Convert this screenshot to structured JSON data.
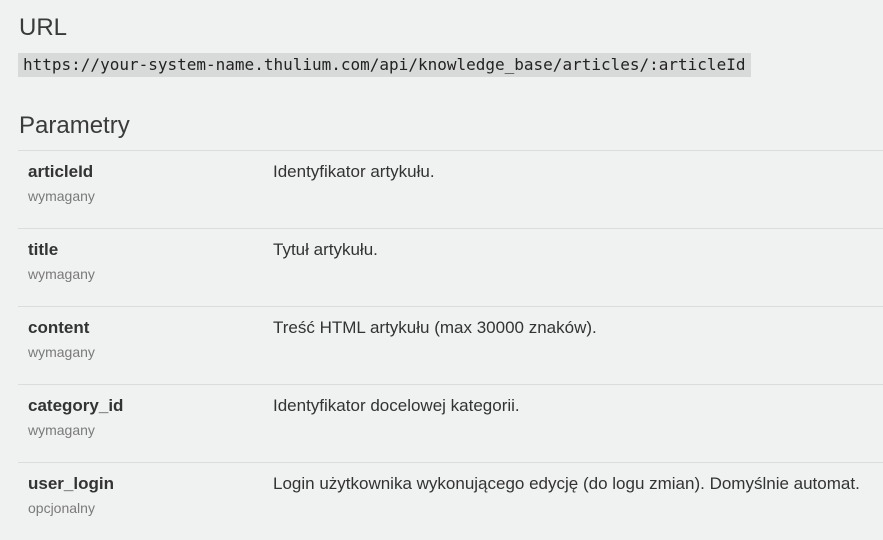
{
  "url_section": {
    "heading": "URL",
    "endpoint": "https://your-system-name.thulium.com/api/knowledge_base/articles/:articleId"
  },
  "params_section": {
    "heading": "Parametry",
    "rows": [
      {
        "name": "articleId",
        "requirement": "wymagany",
        "description": "Identyfikator artykułu."
      },
      {
        "name": "title",
        "requirement": "wymagany",
        "description": "Tytuł artykułu."
      },
      {
        "name": "content",
        "requirement": "wymagany",
        "description": "Treść HTML artykułu (max 30000 znaków)."
      },
      {
        "name": "category_id",
        "requirement": "wymagany",
        "description": "Identyfikator docelowej kategorii."
      },
      {
        "name": "user_login",
        "requirement": "opcjonalny",
        "description": "Login użytkownika wykonującego edycję (do logu zmian). Domyślnie automat."
      }
    ]
  }
}
